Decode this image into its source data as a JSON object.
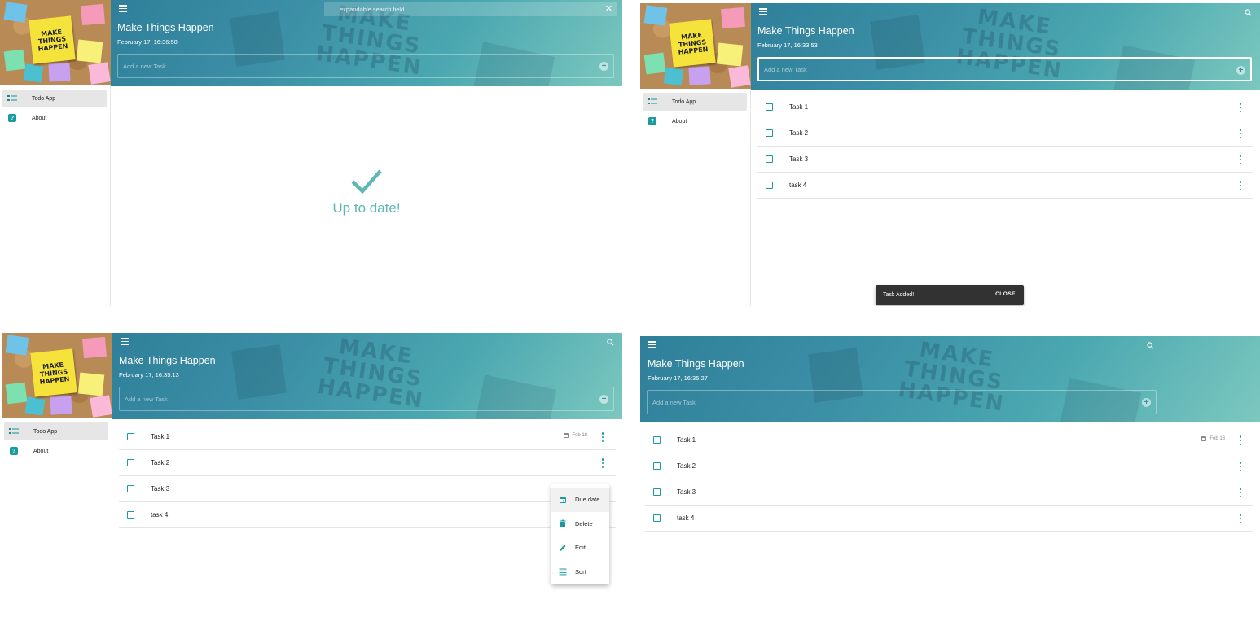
{
  "common": {
    "app_title": "Make Things Happen",
    "note_text": "MAKE THINGS HAPPEN",
    "add_placeholder": "Add a new Task",
    "nav": [
      {
        "label": "Todo App",
        "icon": "list-icon"
      },
      {
        "label": "About",
        "icon": "help-icon"
      }
    ]
  },
  "screens": [
    {
      "date": "February 17, 16:36:58",
      "search": {
        "placeholder": "expandable search field",
        "close_icon": "close-icon",
        "search_icon": "search-icon"
      },
      "empty_state": {
        "text": "Up to date!",
        "icon": "checkmark-icon"
      }
    },
    {
      "date": "February 17, 16:33:53",
      "tasks": [
        {
          "text": "Task 1"
        },
        {
          "text": "Task 2"
        },
        {
          "text": "Task 3"
        },
        {
          "text": "task 4"
        }
      ],
      "snackbar": {
        "message": "Task Added!",
        "action": "CLOSE"
      }
    },
    {
      "date": "February 17, 16:35:13",
      "tasks": [
        {
          "text": "Task 1",
          "due": "Feb 18"
        },
        {
          "text": "Task 2"
        },
        {
          "text": "Task 3"
        },
        {
          "text": "task 4"
        }
      ],
      "context_menu": [
        {
          "label": "Due date",
          "icon": "calendar-icon"
        },
        {
          "label": "Delete",
          "icon": "trash-icon"
        },
        {
          "label": "Edit",
          "icon": "pencil-icon"
        },
        {
          "label": "Sort",
          "icon": "sort-icon"
        }
      ]
    },
    {
      "date": "February 17, 16:35:27",
      "tasks": [
        {
          "text": "Task 1",
          "due": "Feb 18"
        },
        {
          "text": "Task 2"
        },
        {
          "text": "Task 3"
        },
        {
          "text": "task 4"
        }
      ]
    }
  ],
  "colors": {
    "accent": "#1a9b9b",
    "header_start": "#2f7f9a",
    "header_end": "#7cc8bf",
    "success": "#5fb8b4",
    "snackbar": "#323232"
  }
}
